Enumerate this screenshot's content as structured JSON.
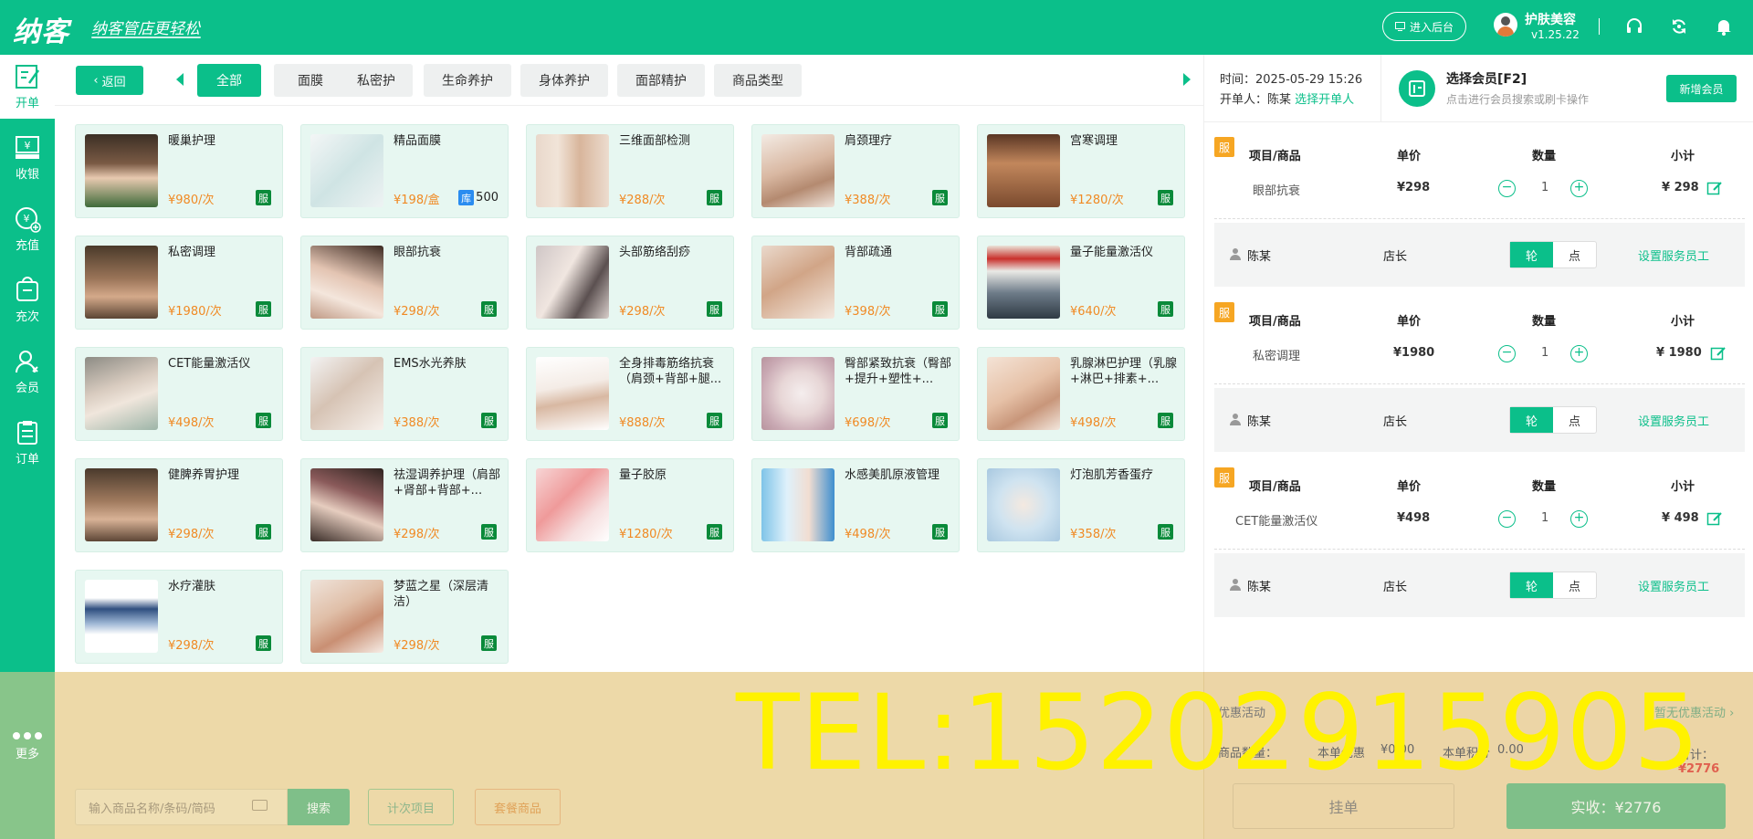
{
  "topbar": {
    "logo_text": "纳客",
    "slogan": "纳客管店更轻松",
    "enter_admin": "进入后台",
    "store_name": "护肤美容",
    "version": "v1.25.22",
    "accent_color": "#0bbf8a"
  },
  "sidebar": {
    "items": [
      {
        "label": "开单",
        "icon": "edit-icon"
      },
      {
        "label": "收银",
        "icon": "cashier-icon"
      },
      {
        "label": "充值",
        "icon": "recharge-icon"
      },
      {
        "label": "充次",
        "icon": "count-recharge-icon"
      },
      {
        "label": "会员",
        "icon": "member-icon"
      },
      {
        "label": "订单",
        "icon": "order-icon"
      }
    ],
    "more": "更多"
  },
  "catbar": {
    "back": "返回",
    "tabs": [
      "全部",
      "面膜",
      "私密护",
      "生命养护",
      "身体养护",
      "面部精护",
      "商品类型"
    ]
  },
  "products": [
    {
      "name": "暖巢护理",
      "price": "¥980/次",
      "badge": "服"
    },
    {
      "name": "精品面膜",
      "price": "¥198/盒",
      "badge": "库",
      "stock": "500"
    },
    {
      "name": "三维面部检测",
      "price": "¥288/次",
      "badge": "服"
    },
    {
      "name": "肩颈理疗",
      "price": "¥388/次",
      "badge": "服"
    },
    {
      "name": "宫寒调理",
      "price": "¥1280/次",
      "badge": "服"
    },
    {
      "name": "私密调理",
      "price": "¥1980/次",
      "badge": "服"
    },
    {
      "name": "眼部抗衰",
      "price": "¥298/次",
      "badge": "服"
    },
    {
      "name": "头部筋络刮痧",
      "price": "¥298/次",
      "badge": "服"
    },
    {
      "name": "背部疏通",
      "price": "¥398/次",
      "badge": "服"
    },
    {
      "name": "量子能量激活仪",
      "price": "¥640/次",
      "badge": "服"
    },
    {
      "name": "CET能量激活仪",
      "price": "¥498/次",
      "badge": "服"
    },
    {
      "name": "EMS水光养肤",
      "price": "¥388/次",
      "badge": "服"
    },
    {
      "name": "全身排毒筋络抗衰（肩颈+背部+腿...",
      "price": "¥888/次",
      "badge": "服"
    },
    {
      "name": "臀部紧致抗衰（臀部+提升+塑性+...",
      "price": "¥698/次",
      "badge": "服"
    },
    {
      "name": "乳腺淋巴护理（乳腺+淋巴+排素+...",
      "price": "¥498/次",
      "badge": "服"
    },
    {
      "name": "健脾养胃护理",
      "price": "¥298/次",
      "badge": "服"
    },
    {
      "name": "祛湿调养护理（肩部+肾部+背部+...",
      "price": "¥298/次",
      "badge": "服"
    },
    {
      "name": "量子胶原",
      "price": "¥1280/次",
      "badge": "服"
    },
    {
      "name": "水感美肌原液管理",
      "price": "¥498/次",
      "badge": "服"
    },
    {
      "name": "灯泡肌芳香蛋疗",
      "price": "¥358/次",
      "badge": "服"
    },
    {
      "name": "水疗灌肤",
      "price": "¥298/次",
      "badge": "服"
    },
    {
      "name": "梦蓝之星（深层清洁）",
      "price": "¥298/次",
      "badge": "服"
    }
  ],
  "right_head": {
    "time_label": "时间：",
    "time": "2025-05-29 15:26",
    "operator_label": "开单人：",
    "operator": "陈某",
    "choose_operator": "选择开单人",
    "member_title": "选择会员[F2]",
    "member_sub": "点击进行会员搜索或刷卡操作",
    "new_member": "新增会员"
  },
  "order_headers": {
    "item": "项目/商品",
    "price": "单价",
    "qty": "数量",
    "subtotal": "小计",
    "flag": "服"
  },
  "orders": [
    {
      "name": "眼部抗衰",
      "price": "¥298",
      "qty": "1",
      "subtotal": "¥ 298",
      "staff": "陈某",
      "role": "店长",
      "seg_on": "轮",
      "seg_off": "点",
      "set_staff": "设置服务员工"
    },
    {
      "name": "私密调理",
      "price": "¥1980",
      "qty": "1",
      "subtotal": "¥ 1980",
      "staff": "陈某",
      "role": "店长",
      "seg_on": "轮",
      "seg_off": "点",
      "set_staff": "设置服务员工"
    },
    {
      "name": "CET能量激活仪",
      "price": "¥498",
      "qty": "1",
      "subtotal": "¥ 498",
      "staff": "陈某",
      "role": "店长",
      "seg_on": "轮",
      "seg_off": "点",
      "set_staff": "设置服务员工"
    }
  ],
  "bottom": {
    "search_placeholder": "输入商品名称/条码/简码",
    "search_btn": "搜索",
    "count_items": "计次项目",
    "packages": "套餐商品",
    "promo_label": "优惠活动",
    "promo_value": "暂无优惠活动 ›",
    "goods_count": "商品数量：",
    "discount_label": "本单优惠",
    "discount_value": "¥0.00",
    "order_label": "本单积分",
    "order_value": "0.00",
    "total_label": "合计：",
    "total_value": "¥2776",
    "hang": "挂单",
    "pay": "实收：¥2776"
  },
  "watermark": "TEL:15202915905"
}
